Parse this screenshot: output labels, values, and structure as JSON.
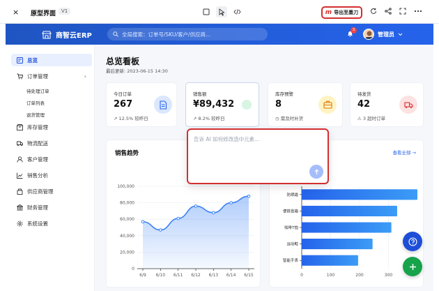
{
  "frame": {
    "close": "×",
    "title": "原型界面",
    "version": "V1",
    "export_label": "导出至墨刀",
    "export_logo": "m"
  },
  "header": {
    "brand": "商智云ERP",
    "search_placeholder": "全局搜索：订单号/SKU/客户/供应商...",
    "notification_count": "3",
    "user_name": "管理员"
  },
  "sidebar": {
    "items": [
      {
        "label": "总览",
        "icon": "dashboard-icon",
        "active": true
      },
      {
        "label": "订单管理",
        "icon": "cart-icon",
        "expanded": true
      },
      {
        "label": "库存管理",
        "icon": "box-icon"
      },
      {
        "label": "物流配送",
        "icon": "truck-icon"
      },
      {
        "label": "客户管理",
        "icon": "user-icon"
      },
      {
        "label": "销售分析",
        "icon": "chart-icon"
      },
      {
        "label": "供应商管理",
        "icon": "supplier-icon"
      },
      {
        "label": "财务管理",
        "icon": "bank-icon"
      },
      {
        "label": "系统设置",
        "icon": "gear-icon"
      }
    ],
    "order_sub": [
      "待处理订单",
      "订单列表",
      "退货管理"
    ]
  },
  "main": {
    "title": "总览看板",
    "updated": "最后更新: 2023-06-15 14:30"
  },
  "cards": [
    {
      "label": "今日订单",
      "value": "267",
      "sub": "12.5% 较昨日",
      "icon": "document-icon",
      "color": "#2563eb",
      "bg": "#dbe7ff"
    },
    {
      "label": "销售额",
      "value": "¥89,432",
      "sub": "8.2% 较昨日",
      "icon": "dot-icon",
      "color": "#16a34a",
      "bg": "#d7f5e2"
    },
    {
      "label": "库存预警",
      "value": "8",
      "sub": "需及时补货",
      "icon": "briefcase-icon",
      "color": "#d97706",
      "bg": "#fff3c4"
    },
    {
      "label": "待发货",
      "value": "42",
      "sub": "3 超时订单",
      "icon": "truck-icon",
      "color": "#dc2626",
      "bg": "#fde2e2"
    }
  ],
  "sales_panel": {
    "title": "销售趋势"
  },
  "product_panel": {
    "view_all": "查看全部 →"
  },
  "ai_popup": {
    "placeholder": "告诉 AI 如何修改选中元素..."
  },
  "chart_data": [
    {
      "type": "area",
      "title": "",
      "x": [
        "6/9",
        "6/10",
        "6/11",
        "6/12",
        "6/13",
        "6/14",
        "6/15"
      ],
      "series": [
        {
          "values": [
            57000,
            47000,
            61000,
            76000,
            68000,
            80000,
            88000
          ]
        }
      ],
      "y_ticks": [
        "100,000",
        "80,000",
        "60,000",
        "40,000",
        "20,000",
        "0"
      ],
      "ylim": [
        0,
        100000
      ],
      "color": "#3b82f6"
    },
    {
      "type": "bar",
      "orientation": "horizontal",
      "categories": [
        "防晒霜",
        "便携音箱",
        "咖啡T恤",
        "运动鞋",
        "智能手表"
      ],
      "values": [
        400,
        330,
        310,
        245,
        195
      ],
      "x_ticks": [
        "0",
        "100",
        "200",
        "300"
      ],
      "xlim": [
        0,
        400
      ],
      "color": "#3b82f6"
    }
  ]
}
